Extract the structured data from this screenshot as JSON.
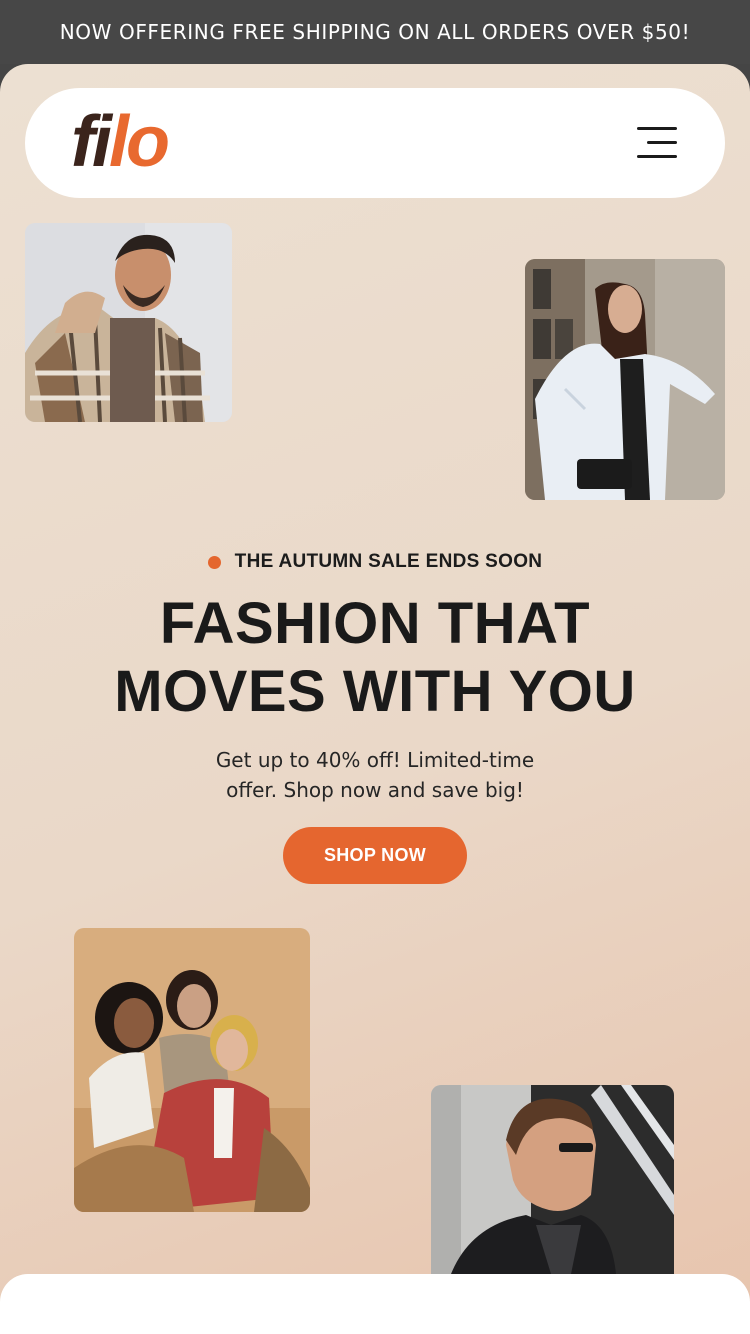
{
  "announcement": {
    "text": "NOW OFFERING FREE SHIPPING ON ALL ORDERS OVER $50!"
  },
  "header": {
    "logo_part1": "fi",
    "logo_part2": "lo",
    "menu_icon": "hamburger-menu-icon"
  },
  "hero": {
    "eyebrow": "THE AUTUMN SALE ENDS SOON",
    "headline_line1": "FASHION THAT",
    "headline_line2": "MOVES WITH YOU",
    "subtext_line1": "Get up to 40% off! Limited-time",
    "subtext_line2": "offer. Shop now and save big!",
    "cta_label": "SHOP NOW"
  },
  "colors": {
    "accent": "#E5662F",
    "logo_dark": "#3B241C",
    "banner_bg": "#474747",
    "hero_bg": "#ECE0D2"
  }
}
